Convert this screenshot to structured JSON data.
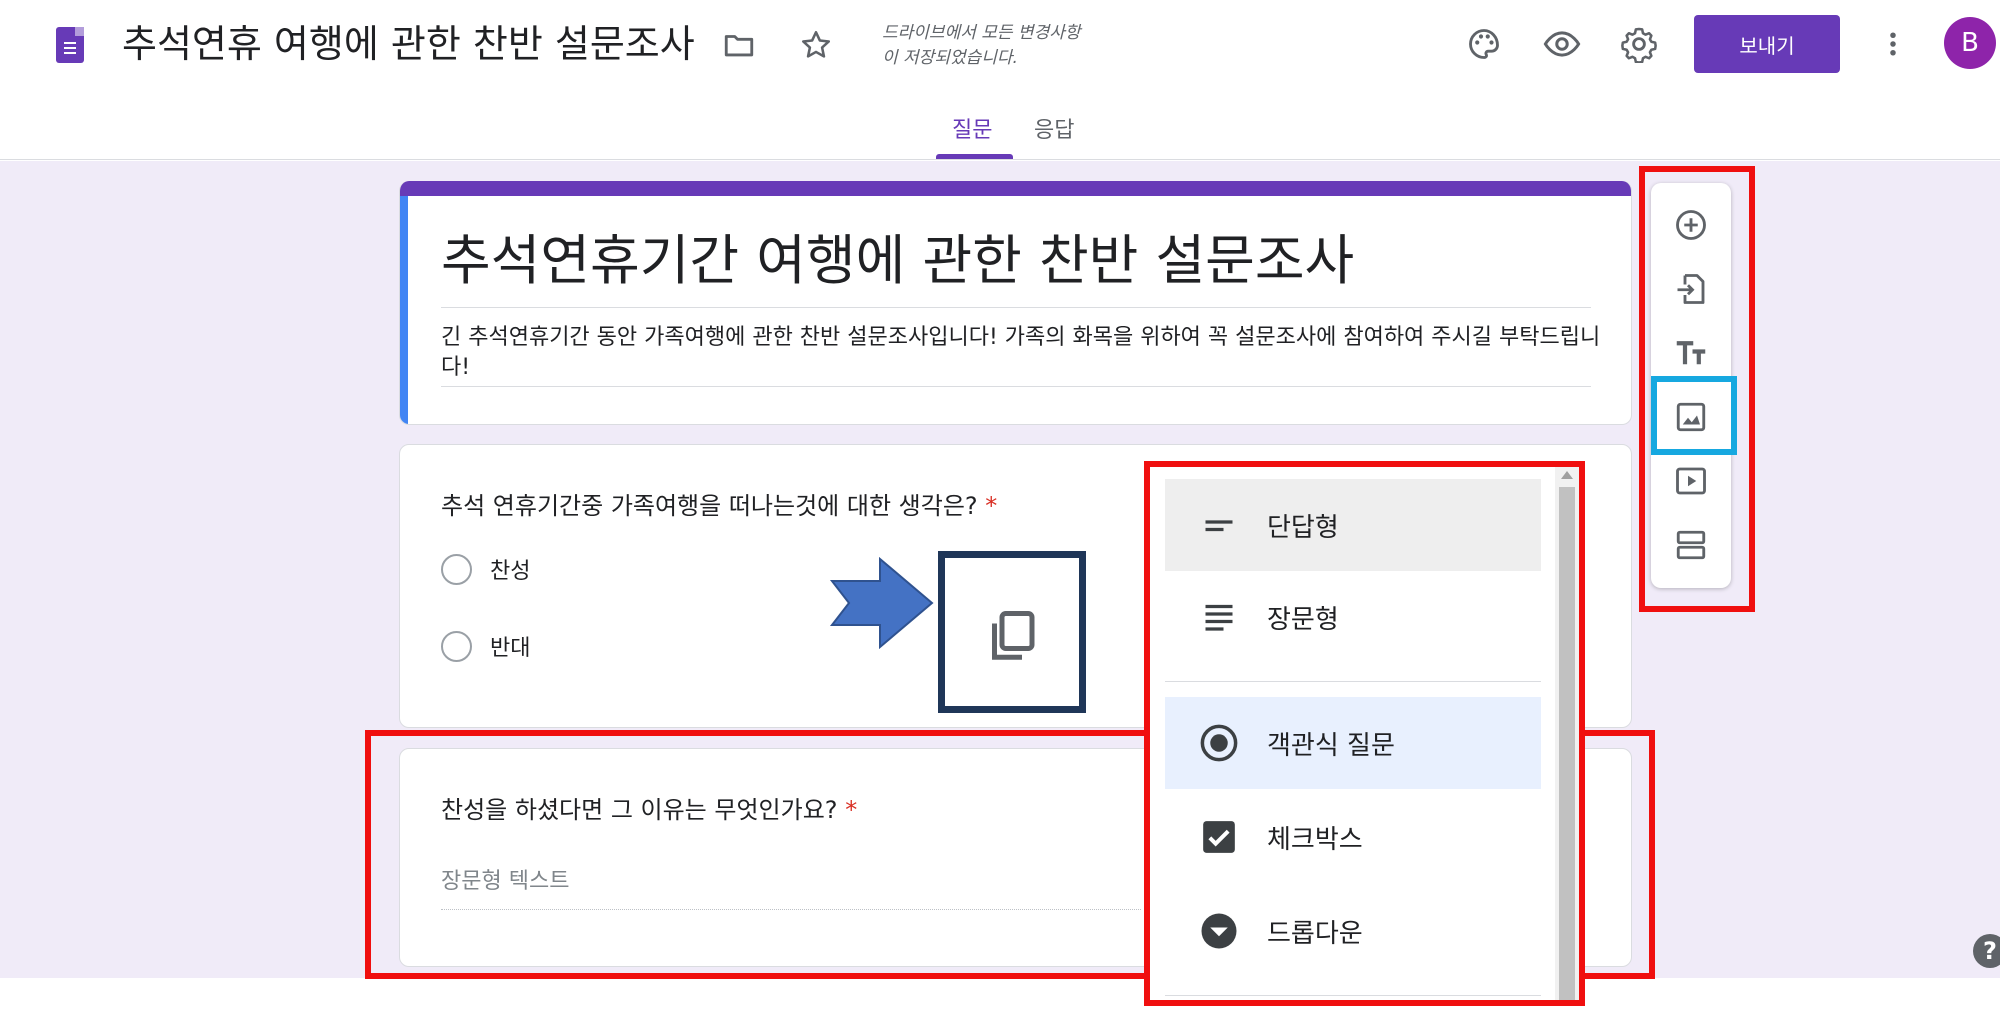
{
  "header": {
    "doc_title": "추석연휴 여행에 관한 찬반 설문조사",
    "save_status_line1": "드라이브에서 모든 변경사항",
    "save_status_line2": "이 저장되었습니다.",
    "send_label": "보내기",
    "avatar_initial": "B"
  },
  "tabs": [
    {
      "label": "질문",
      "active": true
    },
    {
      "label": "응답",
      "active": false
    }
  ],
  "form": {
    "title": "추석연휴기간 여행에 관한 찬반 설문조사",
    "description": "긴 추석연휴기간 동안 가족여행에 관한 찬반 설문조사입니다! 가족의 화목을 위하여 꼭 설문조사에 참여하여 주시길 부탁드립니다!"
  },
  "questions": [
    {
      "title": "추석 연휴기간중 가족여행을 떠나는것에 대한 생각은?",
      "required_mark": "*",
      "options": [
        "찬성",
        "반대"
      ]
    },
    {
      "title": "찬성을 하셨다면 그 이유는 무엇인가요?",
      "required_mark": "*",
      "placeholder": "장문형 텍스트"
    }
  ],
  "question_type_menu": {
    "items": [
      {
        "label": "단답형",
        "icon": "short-answer-icon",
        "state": "hover"
      },
      {
        "label": "장문형",
        "icon": "paragraph-icon",
        "state": "normal"
      },
      {
        "label": "객관식 질문",
        "icon": "radio-icon",
        "state": "selected"
      },
      {
        "label": "체크박스",
        "icon": "checkbox-icon",
        "state": "normal"
      },
      {
        "label": "드롭다운",
        "icon": "dropdown-icon",
        "state": "normal"
      }
    ]
  },
  "side_toolbar": {
    "buttons": [
      "add-question-icon",
      "import-questions-icon",
      "add-title-icon",
      "add-image-icon",
      "add-video-icon",
      "add-section-icon"
    ]
  },
  "help_label": "?",
  "colors": {
    "brand": "#673ab7",
    "accent_blue": "#4285f4",
    "canvas_bg": "#f0ebf8",
    "annotation_red": "#f00f0f",
    "annotation_cyan": "#16a8e0",
    "annotation_navy": "#1f3658",
    "arrow_blue": "#4472c4",
    "required_red": "#d93025"
  }
}
